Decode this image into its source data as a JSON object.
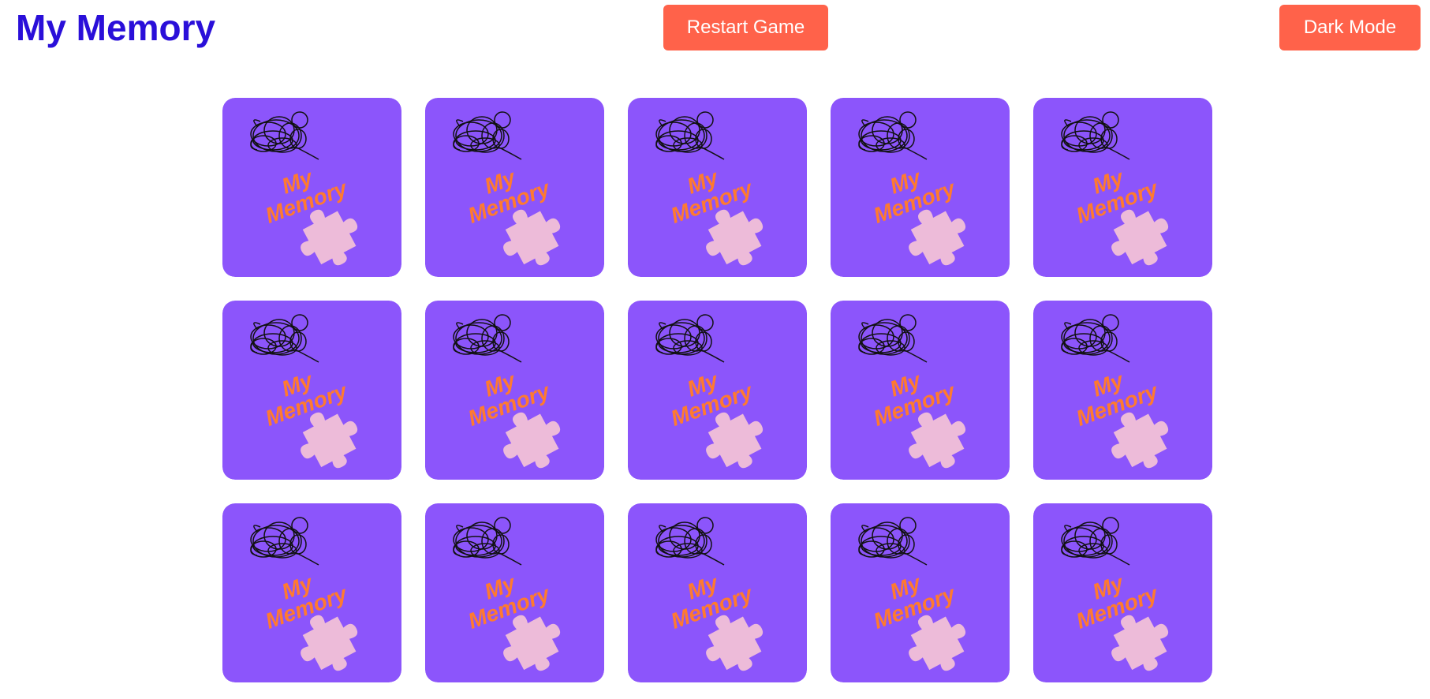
{
  "header": {
    "title": "My Memory",
    "restart_label": "Restart Game",
    "dark_mode_label": "Dark Mode"
  },
  "colors": {
    "title": "#2a0fd9",
    "button": "#ff624a",
    "card_back": "#8c55fb",
    "logo_text": "#ff7a2f",
    "puzzle_piece": "#edbbd9",
    "scribble": "#111111"
  },
  "card_back": {
    "logo_line1": "My",
    "logo_line2": "Memory",
    "icons": [
      "scribble-icon",
      "puzzle-piece-icon"
    ]
  },
  "board": {
    "rows": 3,
    "columns": 5,
    "cards": [
      {
        "state": "face-down"
      },
      {
        "state": "face-down"
      },
      {
        "state": "face-down"
      },
      {
        "state": "face-down"
      },
      {
        "state": "face-down"
      },
      {
        "state": "face-down"
      },
      {
        "state": "face-down"
      },
      {
        "state": "face-down"
      },
      {
        "state": "face-down"
      },
      {
        "state": "face-down"
      },
      {
        "state": "face-down"
      },
      {
        "state": "face-down"
      },
      {
        "state": "face-down"
      },
      {
        "state": "face-down"
      },
      {
        "state": "face-down"
      }
    ]
  }
}
